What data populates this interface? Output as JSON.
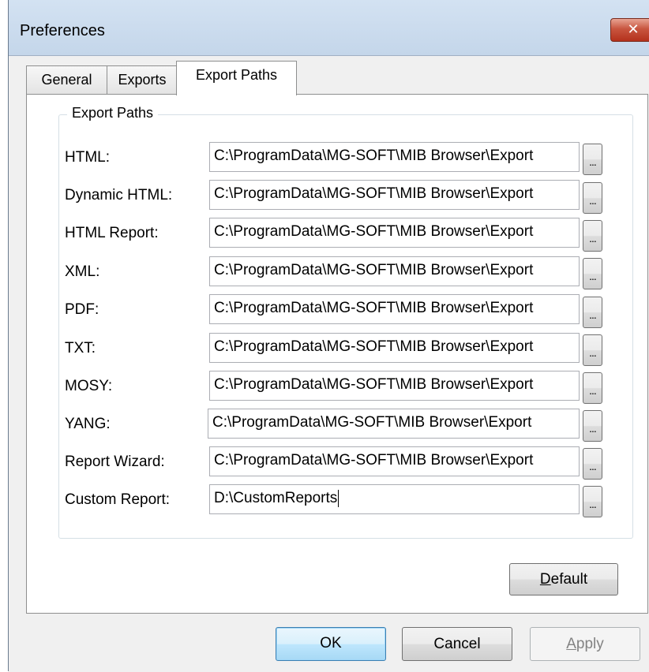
{
  "window": {
    "title": "Preferences",
    "close_glyph": "✕"
  },
  "tabs": [
    {
      "label": "General",
      "active": false
    },
    {
      "label": "Exports",
      "active": false
    },
    {
      "label": "Export Paths",
      "active": true
    }
  ],
  "group": {
    "label": "Export Paths"
  },
  "paths": [
    {
      "label": "HTML:",
      "value": "C:\\ProgramData\\MG-SOFT\\MIB Browser\\Export"
    },
    {
      "label": "Dynamic HTML:",
      "value": "C:\\ProgramData\\MG-SOFT\\MIB Browser\\Export"
    },
    {
      "label": "HTML Report:",
      "value": "C:\\ProgramData\\MG-SOFT\\MIB Browser\\Export"
    },
    {
      "label": "XML:",
      "value": "C:\\ProgramData\\MG-SOFT\\MIB Browser\\Export"
    },
    {
      "label": "PDF:",
      "value": "C:\\ProgramData\\MG-SOFT\\MIB Browser\\Export"
    },
    {
      "label": "TXT:",
      "value": "C:\\ProgramData\\MG-SOFT\\MIB Browser\\Export"
    },
    {
      "label": "MOSY:",
      "value": "C:\\ProgramData\\MG-SOFT\\MIB Browser\\Export"
    },
    {
      "label": "YANG:",
      "value": "C:\\ProgramData\\MG-SOFT\\MIB Browser\\Export"
    },
    {
      "label": "Report Wizard:",
      "value": "C:\\ProgramData\\MG-SOFT\\MIB Browser\\Export"
    },
    {
      "label": "Custom Report:",
      "value": "D:\\CustomReports"
    }
  ],
  "browse_label": "...",
  "buttons": {
    "default_label": "Default",
    "ok_label": "OK",
    "cancel_label": "Cancel",
    "apply_label": "Apply",
    "apply_enabled": false
  }
}
